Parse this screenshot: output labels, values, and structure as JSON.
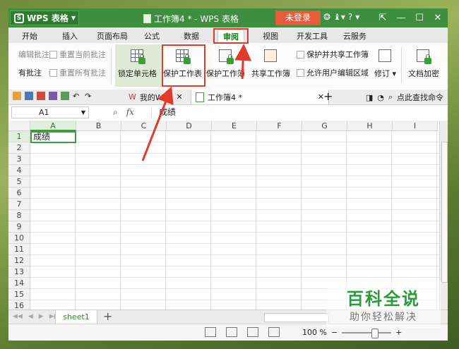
{
  "titlebar": {
    "app_name": "WPS 表格",
    "doc_title": "工作簿4 * - WPS 表格",
    "login_button": "未登录",
    "help_icon_text": "?"
  },
  "menu": {
    "tabs": [
      "开始",
      "插入",
      "页面布局",
      "公式",
      "数据",
      "审阅",
      "视图",
      "开发工具",
      "云服务"
    ],
    "active_tab": "审阅"
  },
  "ribbon": {
    "edit_comment": "编辑批注",
    "reset_current_comment": "重置当前批注",
    "has_comment": "有批注",
    "reset_all_comments": "重置所有批注",
    "lock_cell": "锁定单元格",
    "protect_sheet": "保护工作表",
    "protect_workbook": "保护工作簿",
    "share_workbook": "共享工作簿",
    "protect_and_share": "保护并共享工作簿",
    "allow_user_edit": "允许用户编辑区域",
    "revise": "修订",
    "doc_encrypt": "文档加密"
  },
  "doctabs": {
    "tab1": "我的WPS",
    "tab2": "工作簿4 *",
    "find_command": "点此查找命令"
  },
  "formula_bar": {
    "cell_ref": "A1",
    "fx": "fx",
    "content": "成绩"
  },
  "grid": {
    "columns": [
      "A",
      "B",
      "C",
      "D",
      "E",
      "F",
      "G",
      "H",
      "I"
    ],
    "rows": [
      "1",
      "2",
      "3",
      "4",
      "5",
      "6",
      "7",
      "8",
      "9",
      "10",
      "11",
      "12",
      "13",
      "14",
      "15",
      "16"
    ],
    "a1_value": "成绩"
  },
  "sheet_tabs": {
    "sheet1": "sheet1",
    "add": "+"
  },
  "status": {
    "zoom": "100 %"
  },
  "watermark": {
    "title": "百科全说",
    "subtitle": "助你轻松解决"
  },
  "colors": {
    "title_green": "#3f8d3f",
    "accent_green": "#3b9d3b",
    "login_red": "#e55c3b",
    "annotation_red": "#e03a2a"
  }
}
